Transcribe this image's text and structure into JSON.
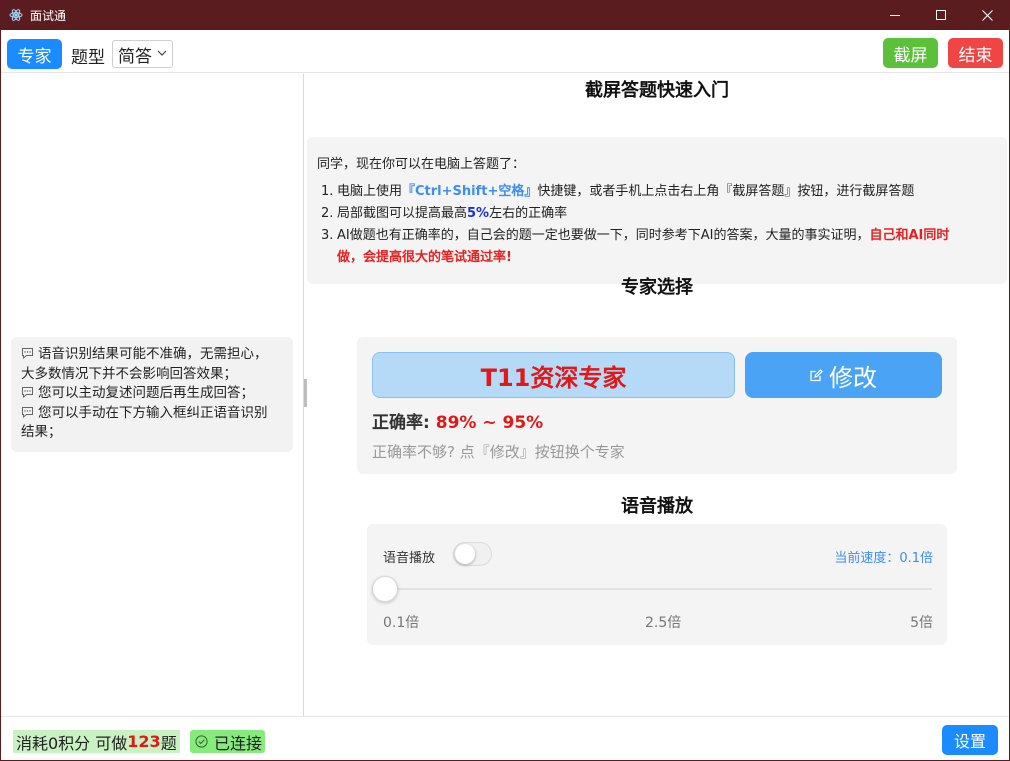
{
  "window": {
    "title": "面试通"
  },
  "toolbar": {
    "expert_label": "专家",
    "type_label": "题型",
    "type_value": "简答",
    "screenshot_label": "截屏",
    "end_label": "结束"
  },
  "left_tips": {
    "lines": [
      "语音识别结果可能不准确，无需担心，",
      "大多数情况下并不会影响回答效果；",
      "您可以主动复述问题后再生成回答；",
      "您可以手动在下方输入框纠正语音识别",
      "结果；"
    ]
  },
  "intro": {
    "title": "截屏答题快速入门",
    "greeting": "同学，现在你可以在电脑上答题了：",
    "item1": {
      "num": "1.",
      "pre": "电脑上使用",
      "shortcut": "『Ctrl+Shift+空格』",
      "post": "快捷键，或者手机上点击右上角『截屏答题』按钮，进行截屏答题"
    },
    "item2": {
      "num": "2.",
      "pre": "局部截图可以提高最高",
      "percent": "5%",
      "post": "左右的正确率"
    },
    "item3": {
      "num": "3.",
      "pre": "AI做题也有正确率的，自己会的题一定也要做一下，同时参考下AI的答案，大量的事实证明，",
      "highlight1": "自己和AI同时",
      "highlight2": "做，会提高很大的笔试通过率!"
    }
  },
  "expert": {
    "title": "专家选择",
    "name": "T11资深专家",
    "modify_label": "修改",
    "accuracy_label": "正确率:",
    "accuracy_value": "89% ~ 95%",
    "hint": "正确率不够? 点『修改』按钮换个专家"
  },
  "voice": {
    "title": "语音播放",
    "label": "语音播放",
    "toggle_on": false,
    "speed_text": "当前速度：0.1倍",
    "slider_value_fraction": 0,
    "ticks": [
      "0.1倍",
      "2.5倍",
      "5倍"
    ]
  },
  "status": {
    "points_pre": "消耗0积分 可做",
    "points_num": "123",
    "points_post": "题",
    "connected_label": "已连接",
    "settings_label": "设置"
  },
  "colors": {
    "titlebar": "#5a1c1f",
    "primary": "#1a8cff",
    "success": "#5cc13a",
    "danger": "#ef4545",
    "accent_red": "#e01818"
  }
}
